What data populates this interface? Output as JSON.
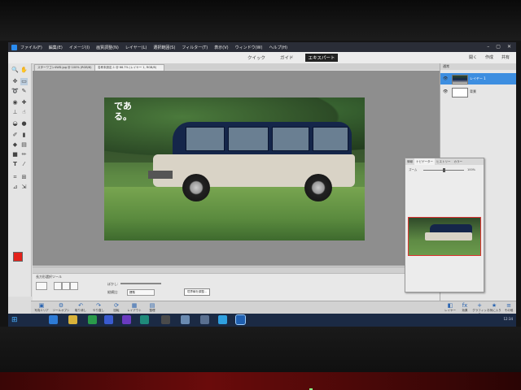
{
  "menubar": {
    "items": [
      "ファイル(F)",
      "編集(E)",
      "イメージ(I)",
      "画質調整(N)",
      "レイヤー(L)",
      "選択範囲(S)",
      "フィルター(T)",
      "表示(V)",
      "ウィンドウ(W)",
      "ヘルプ(H)"
    ]
  },
  "mode_tabs": {
    "quick": "クイック",
    "guided": "ガイド",
    "expert": "エキスパート"
  },
  "top_right": {
    "open": "開く",
    "create": "作成",
    "share": "共有"
  },
  "colors": {
    "foreground": "#e3221b",
    "background": "#ffffff",
    "accent": "#2a8cf0"
  },
  "doc_tabs": [
    "スターワゴン4WD.jpg @ 100% (RGB/8)",
    "名称未設定-1 @ 66.7% (レイヤー 1, RGB/8)"
  ],
  "image": {
    "overlay_text": "である。"
  },
  "options": {
    "title": "長方形選択ツール",
    "label_feather": "ぼかし:",
    "label_mode": "縦横比:",
    "mode_value": "標準",
    "refine_button": "境界線を調整..."
  },
  "bottom_bar": {
    "items": [
      "写真エリア",
      "ツールオプション",
      "取り消し",
      "やり直し",
      "回転",
      "レイアウト",
      "整理"
    ],
    "right": [
      "レイヤー",
      "効果",
      "グラフィック",
      "お気に入り",
      "その他"
    ]
  },
  "layers": {
    "header": "通常",
    "rows": [
      "レイヤー 1",
      "背景"
    ]
  },
  "navigator": {
    "tabs": [
      "情報",
      "ナビゲーター",
      "ヒストリー",
      "カラー"
    ],
    "zoom_label": "ズーム",
    "zoom_pct": "100%"
  },
  "taskbar": {
    "clock": "12:34"
  }
}
